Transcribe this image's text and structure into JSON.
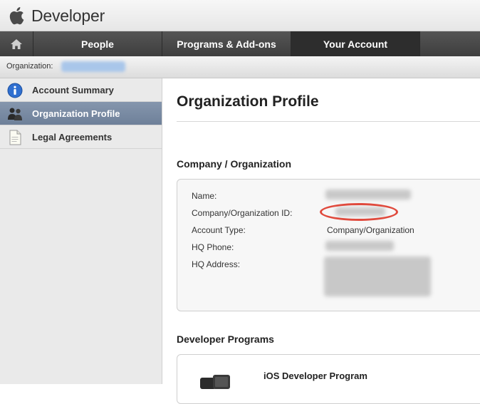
{
  "header": {
    "brand": "Developer",
    "logo_icon": "apple-logo-icon"
  },
  "nav": {
    "home_icon": "home-icon",
    "tabs": [
      {
        "label": "People"
      },
      {
        "label": "Programs & Add-ons"
      },
      {
        "label": "Your Account",
        "active": true
      }
    ]
  },
  "org_bar": {
    "label": "Organization:"
  },
  "sidebar": {
    "items": [
      {
        "label": "Account Summary",
        "icon": "info-icon"
      },
      {
        "label": "Organization Profile",
        "icon": "people-icon",
        "active": true
      },
      {
        "label": "Legal Agreements",
        "icon": "document-icon"
      }
    ]
  },
  "main": {
    "title": "Organization Profile",
    "company_section": {
      "title": "Company / Organization",
      "fields": [
        {
          "label": "Name:"
        },
        {
          "label": "Company/Organization ID:"
        },
        {
          "label": "Account Type:",
          "value": "Company/Organization"
        },
        {
          "label": "HQ Phone:"
        },
        {
          "label": "HQ Address:"
        }
      ]
    },
    "programs_section": {
      "title": "Developer Programs",
      "programs": [
        {
          "name": "iOS Developer Program"
        }
      ]
    }
  },
  "colors": {
    "nav_bg": "#3e3e3e",
    "sidebar_active": "#6e8099",
    "highlight_ring": "#e04a3d"
  }
}
